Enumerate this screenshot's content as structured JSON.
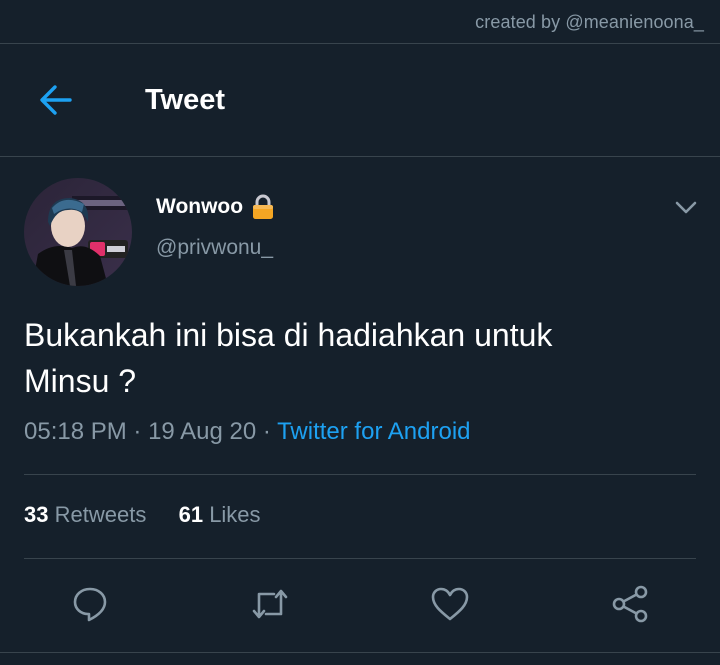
{
  "watermark": "created by @meanienoona_",
  "header": {
    "back_icon": "arrow-left-icon",
    "title": "Tweet"
  },
  "author": {
    "name": "Wonwoo",
    "lock_icon": "lock-icon",
    "handle": "@privwonu_"
  },
  "tweet": {
    "text_line1": "Bukankah ini bisa di hadiahkan untuk",
    "text_line2": "Minsu ?",
    "time": "05:18 PM",
    "sep1": " · ",
    "date": "19 Aug 20",
    "sep2": " · ",
    "source": "Twitter for Android"
  },
  "stats": {
    "retweets_count": "33",
    "retweets_label": "Retweets",
    "likes_count": "61",
    "likes_label": "Likes"
  },
  "actions": [
    "reply-icon",
    "retweet-icon",
    "like-icon",
    "share-icon"
  ],
  "colors": {
    "background": "#15202b",
    "divider": "#38444d",
    "accent": "#1da1f2",
    "secondary_text": "#8899a6",
    "lock": "#f5a623"
  }
}
